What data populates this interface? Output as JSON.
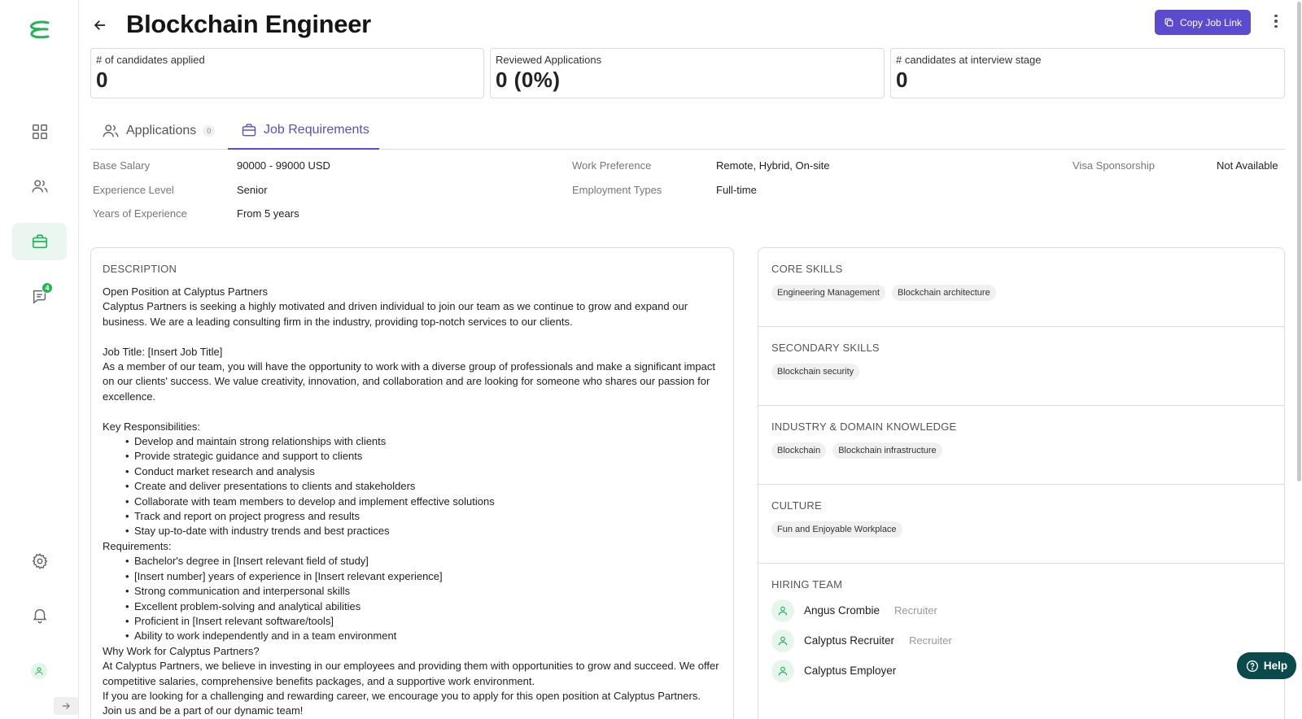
{
  "app": {
    "brand_color": "#22b455",
    "accent_color": "#5b4ccf"
  },
  "sidebar": {
    "items": [
      {
        "icon": "grid-icon",
        "active": false
      },
      {
        "icon": "users-icon",
        "active": false
      },
      {
        "icon": "briefcase-icon",
        "active": true
      },
      {
        "icon": "chat-icon",
        "active": false,
        "badge": "4"
      },
      {
        "icon": "gear-icon",
        "active": false
      },
      {
        "icon": "bell-icon",
        "active": false
      }
    ]
  },
  "header": {
    "title": "Blockchain Engineer",
    "copy_link_label": "Copy Job Link"
  },
  "stats": [
    {
      "label": "# of candidates applied",
      "value": "0"
    },
    {
      "label": "Reviewed Applications",
      "value": "0 (0%)"
    },
    {
      "label": "# candidates at interview stage",
      "value": "0"
    }
  ],
  "tabs": [
    {
      "label": "Applications",
      "count": "0"
    },
    {
      "label": "Job Requirements"
    }
  ],
  "requirements": {
    "base_salary": {
      "label": "Base Salary",
      "value": "90000 - 99000 USD"
    },
    "experience_level": {
      "label": "Experience Level",
      "value": "Senior"
    },
    "years_experience": {
      "label": "Years of Experience",
      "value": "From 5 years"
    },
    "work_preference": {
      "label": "Work Preference",
      "value": "Remote, Hybrid, On-site"
    },
    "employment_types": {
      "label": "Employment Types",
      "value": "Full-time"
    },
    "visa_sponsorship": {
      "label": "Visa Sponsorship",
      "value": "Not Available"
    }
  },
  "description": {
    "heading": "DESCRIPTION",
    "intro_title": "Open Position at Calyptus Partners",
    "intro": "Calyptus Partners is seeking a highly motivated and driven individual to join our team as we continue to grow and expand our business. We are a leading consulting firm in the industry, providing top-notch services to our clients.",
    "job_title_line": "Job Title: [Insert Job Title]",
    "member_text": "As a member of our team, you will have the opportunity to work with a diverse group of professionals and make a significant impact on our clients' success. We value creativity, innovation, and collaboration and are looking for someone who shares our passion for excellence.",
    "responsibilities_heading": "Key Responsibilities:",
    "responsibilities": [
      "Develop and maintain strong relationships with clients",
      "Provide strategic guidance and support to clients",
      "Conduct market research and analysis",
      "Create and deliver presentations to clients and stakeholders",
      "Collaborate with team members to develop and implement effective solutions",
      "Track and report on project progress and results",
      "Stay up-to-date with industry trends and best practices"
    ],
    "requirements_heading": "Requirements:",
    "requirements": [
      "Bachelor's degree in [Insert relevant field of study]",
      "[Insert number] years of experience in [Insert relevant experience]",
      "Strong communication and interpersonal skills",
      "Excellent problem-solving and analytical abilities",
      "Proficient in [Insert relevant software/tools]",
      "Ability to work independently and in a team environment"
    ],
    "why_heading": "Why Work for Calyptus Partners?",
    "why_text": "At Calyptus Partners, we believe in investing in our employees and providing them with opportunities to grow and succeed. We offer competitive salaries, comprehensive benefits packages, and a supportive work environment.",
    "closing": "If you are looking for a challenging and rewarding career, we encourage you to apply for this open position at Calyptus Partners. Join us and be a part of our dynamic team!"
  },
  "skills": {
    "core": {
      "heading": "CORE SKILLS",
      "items": [
        "Engineering Management",
        "Blockchain architecture"
      ]
    },
    "secondary": {
      "heading": "SECONDARY SKILLS",
      "items": [
        "Blockchain security"
      ]
    },
    "industry": {
      "heading": "INDUSTRY & DOMAIN KNOWLEDGE",
      "items": [
        "Blockchain",
        "Blockchain infrastructure"
      ]
    },
    "culture": {
      "heading": "CULTURE",
      "items": [
        "Fun and Enjoyable Workplace"
      ]
    }
  },
  "hiring_team": {
    "heading": "HIRING TEAM",
    "members": [
      {
        "name": "Angus Crombie",
        "role": "Recruiter"
      },
      {
        "name": "Calyptus Recruiter",
        "role": "Recruiter"
      },
      {
        "name": "Calyptus Employer",
        "role": ""
      }
    ]
  },
  "help": {
    "label": "Help"
  }
}
